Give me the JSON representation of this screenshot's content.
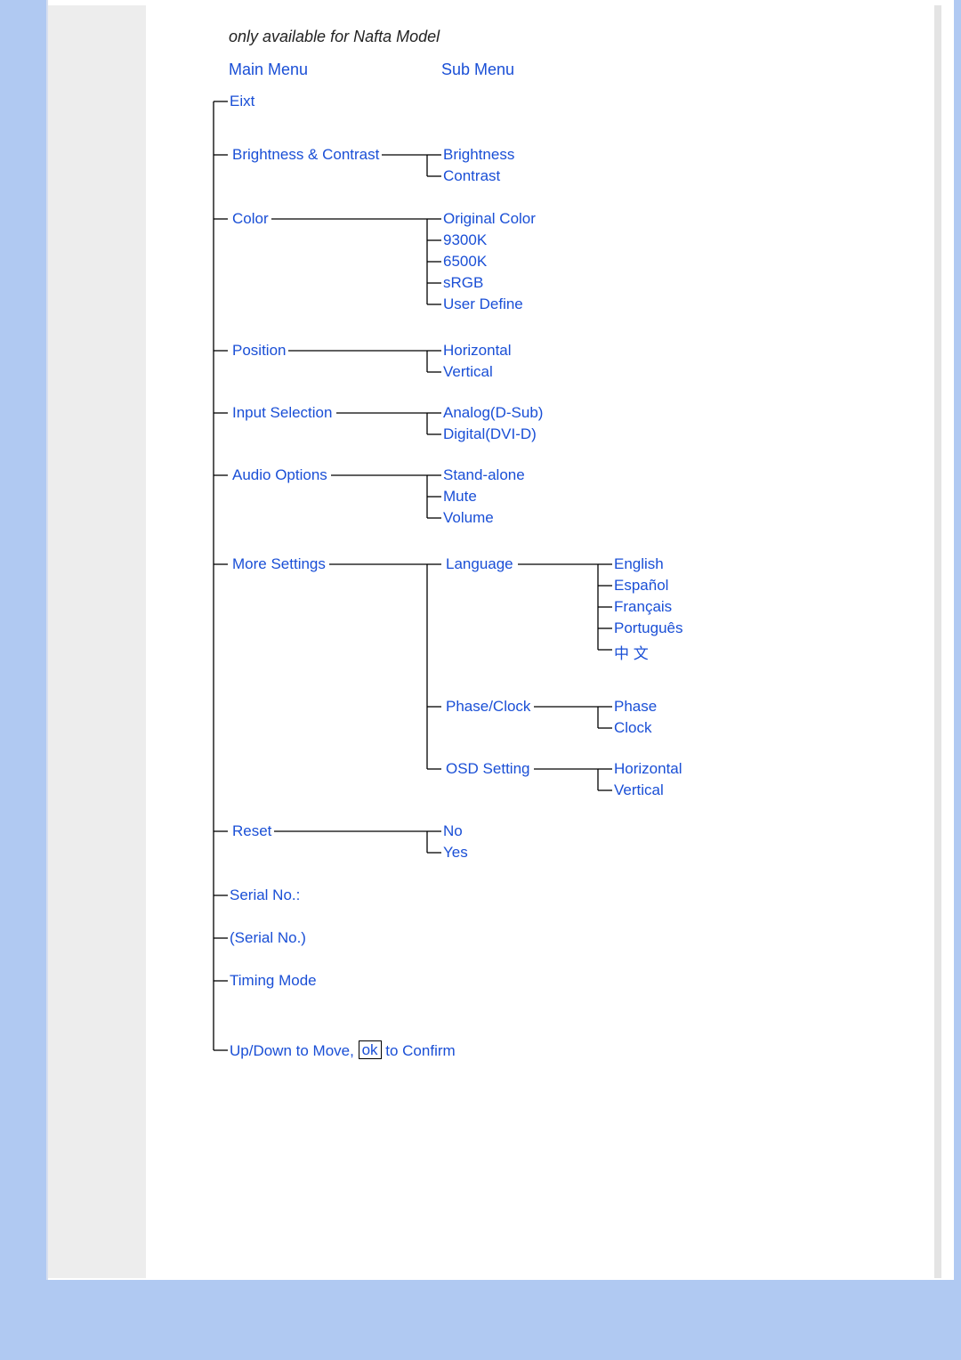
{
  "note": "only available for Nafta Model",
  "headers": {
    "main": "Main Menu",
    "sub": "Sub Menu"
  },
  "main": {
    "exit": "Eixt",
    "brightness_contrast": "Brightness & Contrast",
    "color": "Color",
    "position": "Position",
    "input_selection": "Input Selection",
    "audio_options": "Audio Options",
    "more_settings": "More Settings",
    "reset": "Reset",
    "serial_no_label": "Serial No.:",
    "serial_no_value": "(Serial No.)",
    "timing_mode": "Timing Mode",
    "instruction_prefix": "Up/Down to Move, ",
    "instruction_ok": "ok",
    "instruction_suffix": " to Confirm"
  },
  "sub": {
    "brightness": "Brightness",
    "contrast": "Contrast",
    "original_color": "Original Color",
    "c9300k": "9300K",
    "c6500k": "6500K",
    "srgb": "sRGB",
    "user_define": "User Define",
    "horizontal": "Horizontal",
    "vertical": "Vertical",
    "analog": "Analog(D-Sub)",
    "digital": "Digital(DVI-D)",
    "standalone": "Stand-alone",
    "mute": "Mute",
    "volume": "Volume",
    "language": "Language",
    "phase_clock": "Phase/Clock",
    "osd_setting": "OSD Setting",
    "reset_no": "No",
    "reset_yes": "Yes"
  },
  "sub2": {
    "english": "English",
    "espanol": "Español",
    "francais": "Français",
    "portugues": "Português",
    "chinese": "中 文",
    "phase": "Phase",
    "clock": "Clock",
    "osd_h": "Horizontal",
    "osd_v": "Vertical"
  }
}
